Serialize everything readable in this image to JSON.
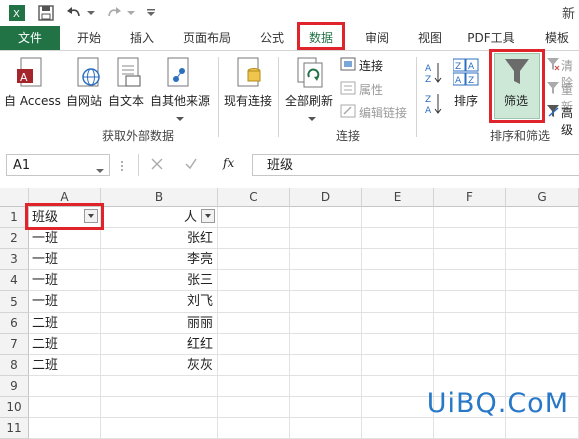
{
  "titlebar": {
    "title_fragment": "新"
  },
  "tabs": [
    {
      "label": "文件"
    },
    {
      "label": "开始"
    },
    {
      "label": "插入"
    },
    {
      "label": "页面布局"
    },
    {
      "label": "公式"
    },
    {
      "label": "数据"
    },
    {
      "label": "审阅"
    },
    {
      "label": "视图"
    },
    {
      "label": "PDF工具"
    },
    {
      "label": "模板"
    }
  ],
  "ribbon": {
    "external": {
      "access": "自 Access",
      "web": "自网站",
      "text": "自文本",
      "other": "自其他来源",
      "group_label": "获取外部数据"
    },
    "existing_conn": "现有连接",
    "connections": {
      "refresh_all": "全部刷新",
      "connections": "连接",
      "properties": "属性",
      "edit_links": "编辑链接",
      "group_label": "连接"
    },
    "sort_filter": {
      "sort": "排序",
      "filter": "筛选",
      "clear": "清除",
      "reapply": "重新",
      "advanced": "高级",
      "group_label": "排序和筛选"
    }
  },
  "formula_bar": {
    "namebox": "A1",
    "fx": "fx",
    "value": "班级"
  },
  "sheet": {
    "columns": [
      "A",
      "B",
      "C",
      "D",
      "E",
      "F",
      "G"
    ],
    "rows": [
      {
        "num": "1",
        "a": "班级",
        "b": "人"
      },
      {
        "num": "2",
        "a": "一班",
        "b": "张红"
      },
      {
        "num": "3",
        "a": "一班",
        "b": "李亮"
      },
      {
        "num": "4",
        "a": "一班",
        "b": "张三"
      },
      {
        "num": "5",
        "a": "一班",
        "b": "刘飞"
      },
      {
        "num": "6",
        "a": "二班",
        "b": "丽丽"
      },
      {
        "num": "7",
        "a": "二班",
        "b": "红红"
      },
      {
        "num": "8",
        "a": "二班",
        "b": "灰灰"
      },
      {
        "num": "9",
        "a": "",
        "b": ""
      },
      {
        "num": "10",
        "a": "",
        "b": ""
      },
      {
        "num": "11",
        "a": "",
        "b": ""
      }
    ]
  },
  "watermark": "UiBQ.CoM",
  "colors": {
    "excel_green": "#217346",
    "highlight_red": "#e0242b",
    "filter_active": "#cde8d7"
  }
}
